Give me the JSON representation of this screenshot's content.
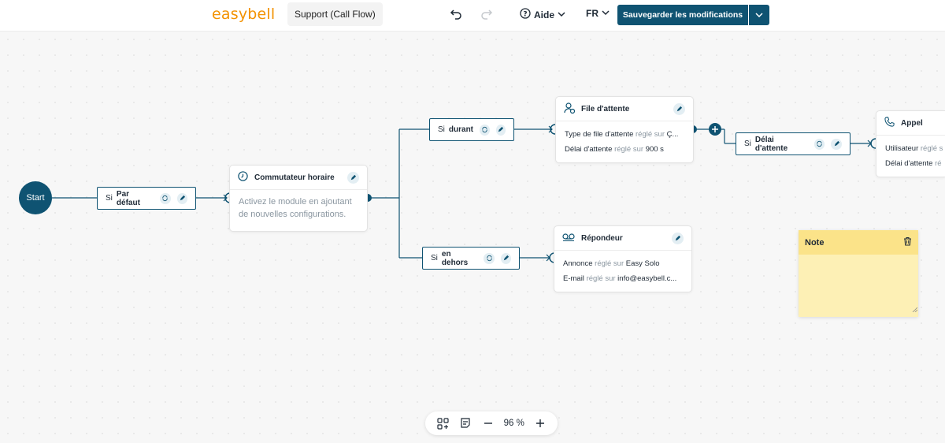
{
  "app": {
    "logo": "easybell",
    "flow_name": "Support (Call Flow)"
  },
  "header": {
    "help_label": "Aide",
    "language": "FR",
    "save_label": "Sauvegarder les modifications"
  },
  "flow": {
    "start_label": "Start",
    "conditions": [
      {
        "prefix": "Si",
        "label": "Par défaut"
      },
      {
        "prefix": "Si",
        "label": "durant"
      },
      {
        "prefix": "Si",
        "label": "en dehors"
      },
      {
        "prefix": "Si",
        "label": "Délai d'attente"
      }
    ],
    "time_switch": {
      "title": "Commutateur horaire",
      "hint": "Activez le module en ajoutant de nouvelles configurations."
    },
    "queue": {
      "title": "File d'attente",
      "rows": [
        {
          "key": "Type de file d'attente",
          "mid": "réglé sur",
          "val": "Ç..."
        },
        {
          "key": "Délai d'attente",
          "mid": "réglé sur",
          "val": "900 s"
        }
      ]
    },
    "voicemail": {
      "title": "Répondeur",
      "rows": [
        {
          "key": "Annonce",
          "mid": "réglé sur",
          "val": "Easy Solo"
        },
        {
          "key": "E-mail",
          "mid": "réglé sur",
          "val": "info@easybell.c..."
        }
      ]
    },
    "call": {
      "title": "Appel",
      "rows": [
        {
          "key": "Utilisateur",
          "mid": "réglé s",
          "val": ""
        },
        {
          "key": "Délai d'attente",
          "mid": "ré",
          "val": ""
        }
      ]
    }
  },
  "note": {
    "title": "Note"
  },
  "zoom": {
    "level": "96 %"
  },
  "colors": {
    "primary": "#0f5372",
    "brand": "#f39200",
    "note": "#fdf0b5"
  }
}
